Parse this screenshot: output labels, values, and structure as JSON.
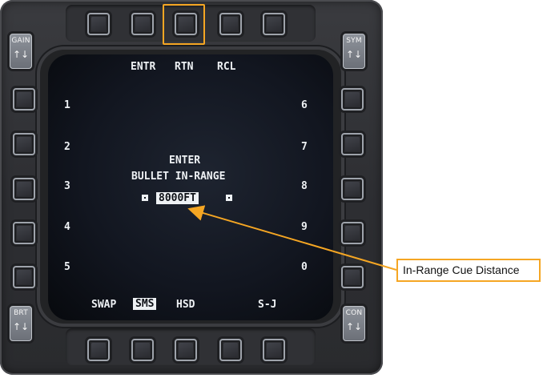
{
  "mfd": {
    "top_row": [
      "ENTR",
      "RTN",
      "RCL"
    ],
    "left_numbers": [
      "1",
      "2",
      "3",
      "4",
      "5"
    ],
    "right_numbers": [
      "6",
      "7",
      "8",
      "9",
      "0"
    ],
    "bottom_row": {
      "swap": "SWAP",
      "sms": "SMS",
      "hsd": "HSD",
      "sj": "S-J"
    },
    "prompt_line1": "ENTER",
    "prompt_line2": "BULLET IN-RANGE",
    "scratchpad_value": "8000FT",
    "rockers": {
      "gain": "GAIN",
      "sym": "SYM",
      "brt": "BRT",
      "con": "CON",
      "up_arrow": "↑",
      "down_arrow": "↓"
    }
  },
  "annotation": {
    "label": "In-Range Cue Distance",
    "color": "#f5a623"
  }
}
